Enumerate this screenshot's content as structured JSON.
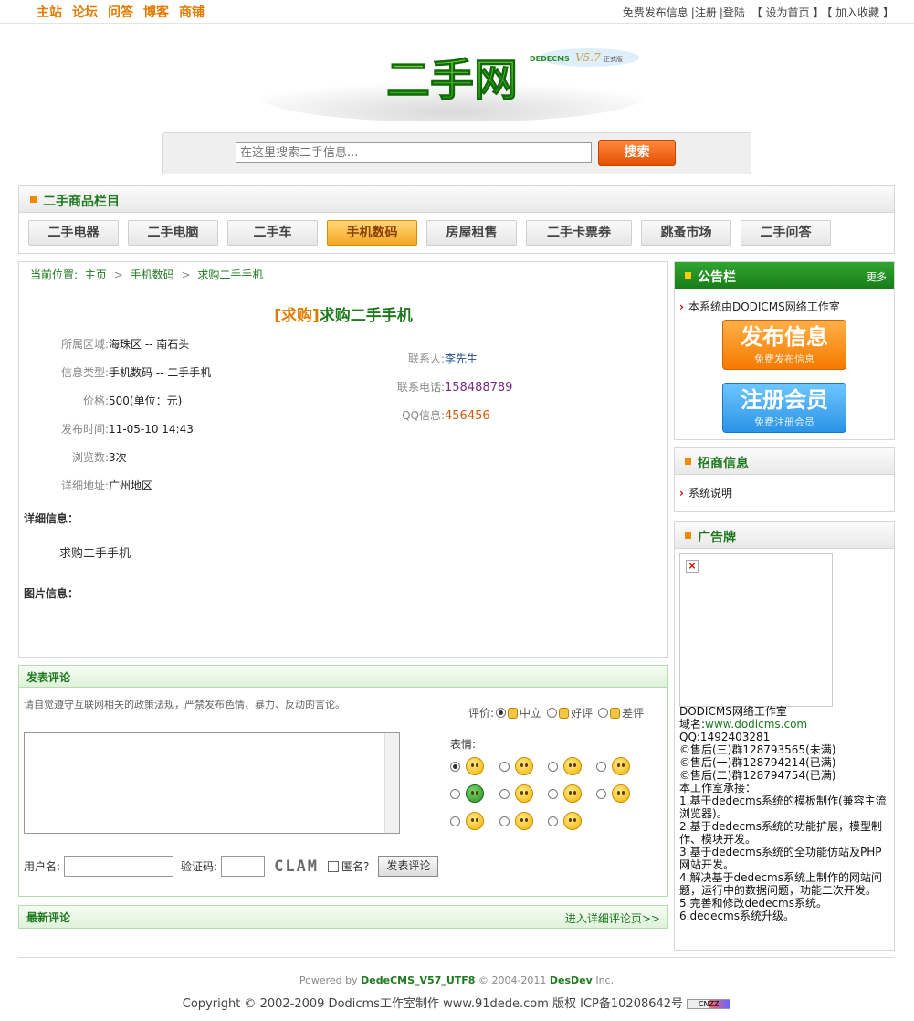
{
  "topnav": {
    "main_links": [
      "主站",
      "论坛",
      "问答",
      "博客",
      "商铺"
    ],
    "right_links": [
      "免费发布信息",
      "|注册",
      "|登陆",
      "【 设为首页 】",
      "【 加入收藏 】"
    ]
  },
  "logo": {
    "main": "二手网",
    "badge": "DEDECMS",
    "version": "V5.7",
    "edition": "正式版"
  },
  "search": {
    "placeholder": "在这里搜索二手信息...",
    "button": "搜索"
  },
  "categories": {
    "title": "二手商品栏目",
    "items": [
      "二手电器",
      "二手电脑",
      "二手车",
      "手机数码",
      "房屋租售",
      "二手卡票券",
      "跳蚤市场",
      "二手问答"
    ],
    "active": "手机数码"
  },
  "breadcrumb": {
    "label": "当前位置:",
    "items": [
      "主页",
      "手机数码",
      "求购二手手机"
    ],
    "sep": ">"
  },
  "post": {
    "tag": "[求购]",
    "title": "求购二手手机",
    "fields_left": [
      {
        "label": "所属区域:",
        "value": "海珠区 -- 南石头"
      },
      {
        "label": "信息类型:",
        "value": "手机数码 -- 二手手机"
      },
      {
        "label": "价格:",
        "value": "500(单位：元)"
      },
      {
        "label": "发布时间:",
        "value": "11-05-10 14:43"
      },
      {
        "label": "浏览数:",
        "value": "3次"
      },
      {
        "label": "详细地址:",
        "value": "广州地区"
      }
    ],
    "fields_right": [
      {
        "label": "联系人:",
        "value": "李先生"
      },
      {
        "label": "联系电话:",
        "value": "158488789"
      },
      {
        "label": "QQ信息:",
        "value": "456456"
      }
    ],
    "detail_heading": "详细信息：",
    "detail_text": "求购二手手机",
    "images_heading": "图片信息："
  },
  "comment_form": {
    "title": "发表评论",
    "notice": "请自觉遵守互联网相关的政策法规，严禁发布色情、暴力、反动的言论。",
    "rating_label": "评价:",
    "ratings": [
      "中立",
      "好评",
      "差评"
    ],
    "emoji_label": "表情:",
    "username_label": "用户名:",
    "captcha_label": "验证码:",
    "captcha_text": "CLAM",
    "anonymous_label": "匿名?",
    "submit": "发表评论"
  },
  "latest_comments": {
    "title": "最新评论",
    "more": "进入详细评论页>>"
  },
  "sidebar": {
    "notice": {
      "title": "公告栏",
      "more": "更多",
      "item": "本系统由DODICMS网络工作室"
    },
    "publish_btn": {
      "main": "发布信息",
      "sub": "免费发布信息"
    },
    "register_btn": {
      "main": "注册会员",
      "sub": "免费注册会员"
    },
    "invest": {
      "title": "招商信息",
      "item": "系统说明"
    },
    "ads": {
      "title": "广告牌",
      "studio": "DODICMS网络工作室",
      "domain_label": "域名:",
      "domain": "www.dodicms.com",
      "lines": [
        "QQ:1492403281",
        "©售后(三)群128793565(未满)",
        "©售后(一)群128794214(已满)",
        "©售后(二)群128794754(已满)",
        "本工作室承接：",
        "1.基于dedecms系统的模板制作(兼容主流浏览器)。",
        "2.基于dedecms系统的功能扩展，模型制作、模块开发。",
        "3.基于dedecms系统的全功能仿站及PHP网站开发。",
        "4.解决基于dedecms系统上制作的网站问题，运行中的数据问题，功能二次开发。",
        "5.完善和修改dedecms系统。",
        "6.dedecms系统升级。"
      ]
    }
  },
  "footer": {
    "powered_prefix": "Powered by",
    "powered_product": "DedeCMS_V57_UTF8",
    "powered_years": "© 2004-2011",
    "powered_company": "DesDev",
    "powered_suffix": "Inc.",
    "copyright": "Copyright © 2002-2009 Dodicms工作室制作 www.91dede.com 版权  ICP备10208642号",
    "cnzz": "CNZZ"
  },
  "colors": {
    "green": "#1f7a1f",
    "orange": "#e07b00",
    "accent_button": "#f57a00"
  }
}
